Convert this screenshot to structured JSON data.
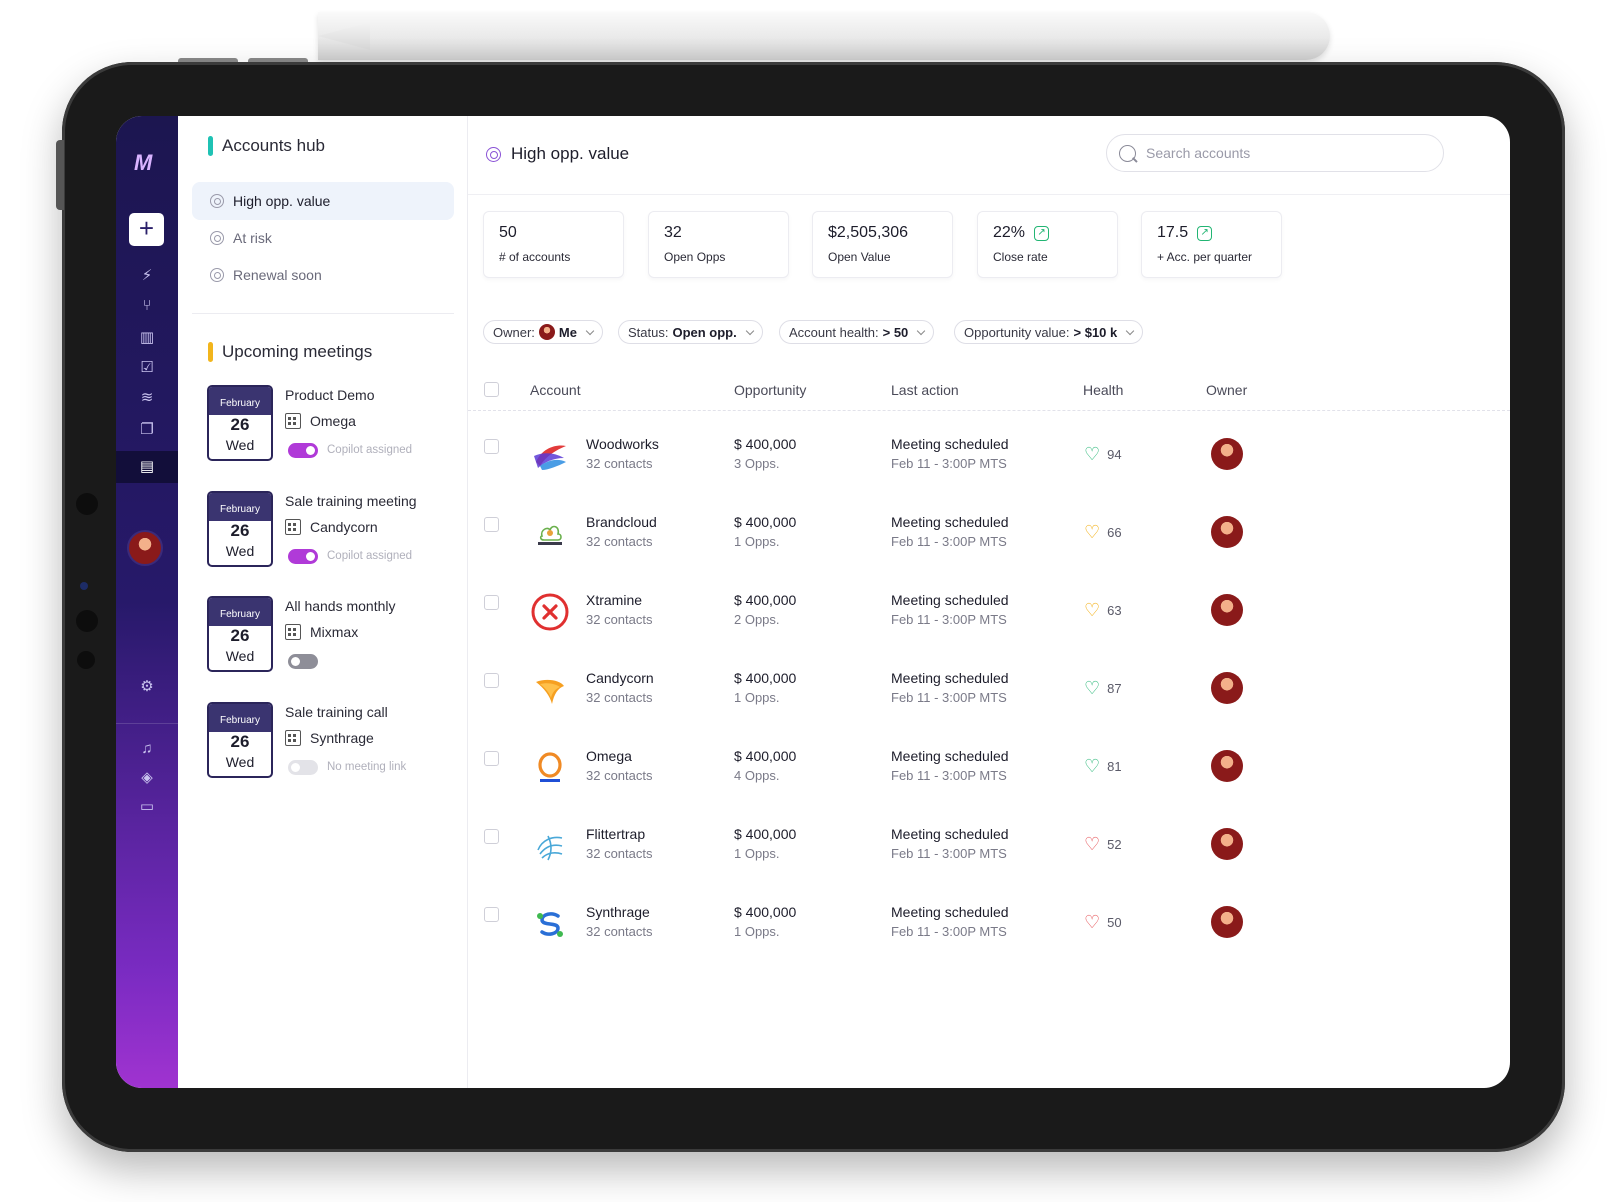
{
  "rail": {
    "logo_text": "M",
    "icons": [
      "plus-icon",
      "lightning-icon",
      "branch-icon",
      "chart-icon",
      "clipboard-icon",
      "layers-icon",
      "copy-icon",
      "document-icon",
      "gear-icon",
      "bell-icon",
      "graduation-cap-icon",
      "book-icon"
    ]
  },
  "hub": {
    "title": "Accounts hub",
    "accent_color": "#1fc2b4",
    "items": [
      {
        "label": "High opp. value",
        "active": true
      },
      {
        "label": "At risk",
        "active": false
      },
      {
        "label": "Renewal soon",
        "active": false
      }
    ]
  },
  "meetings": {
    "title": "Upcoming meetings",
    "accent_color": "#f2b51c",
    "items": [
      {
        "month": "February",
        "day": "26",
        "weekday": "Wed",
        "title": "Product Demo",
        "company": "Omega",
        "toggle": "on",
        "note": "Copilot assigned"
      },
      {
        "month": "February",
        "day": "26",
        "weekday": "Wed",
        "title": "Sale training meeting",
        "company": "Candycorn",
        "toggle": "on",
        "note": "Copilot assigned"
      },
      {
        "month": "February",
        "day": "26",
        "weekday": "Wed",
        "title": "All hands monthly",
        "company": "Mixmax",
        "toggle": "off",
        "note": ""
      },
      {
        "month": "February",
        "day": "26",
        "weekday": "Wed",
        "title": "Sale training call",
        "company": "Synthrage",
        "toggle": "disabled",
        "note": "No meeting link"
      }
    ]
  },
  "main": {
    "title": "High opp. value",
    "search_placeholder": "Search accounts",
    "kpis": [
      {
        "value": "50",
        "label": "# of accounts",
        "trend": false
      },
      {
        "value": "32",
        "label": "Open Opps",
        "trend": false
      },
      {
        "value": "$2,505,306",
        "label": "Open Value",
        "trend": false
      },
      {
        "value": "22%",
        "label": "Close rate",
        "trend": true
      },
      {
        "value": "17.5",
        "label": "+ Acc. per quarter",
        "trend": true
      }
    ],
    "filters": [
      {
        "label": "Owner:",
        "value": "Me",
        "avatar": true
      },
      {
        "label": "Status:",
        "value": "Open opp.",
        "avatar": false
      },
      {
        "label": "Account health:",
        "value": "> 50",
        "avatar": false
      },
      {
        "label": "Opportunity value:",
        "value": "> $10 k",
        "avatar": false
      }
    ],
    "columns": {
      "account": "Account",
      "opportunity": "Opportunity",
      "last_action": "Last action",
      "health": "Health",
      "owner": "Owner"
    },
    "rows": [
      {
        "name": "Woodworks",
        "contacts": "32 contacts",
        "value": "$ 400,000",
        "opps": "3 Opps.",
        "action": "Meeting scheduled",
        "action_time": "Feb 11 -  3:00P MTS",
        "health": "94",
        "health_color": "#22b573",
        "logo": "woodworks"
      },
      {
        "name": "Brandcloud",
        "contacts": "32 contacts",
        "value": "$ 400,000",
        "opps": "1 Opps.",
        "action": "Meeting scheduled",
        "action_time": "Feb 11 -  3:00P MTS",
        "health": "66",
        "health_color": "#f2a900",
        "logo": "brandcloud"
      },
      {
        "name": "Xtramine",
        "contacts": "32 contacts",
        "value": "$ 400,000",
        "opps": "2 Opps.",
        "action": "Meeting scheduled",
        "action_time": "Feb 11 -  3:00P MTS",
        "health": "63",
        "health_color": "#f2a900",
        "logo": "xtramine"
      },
      {
        "name": "Candycorn",
        "contacts": "32 contacts",
        "value": "$ 400,000",
        "opps": "1 Opps.",
        "action": "Meeting scheduled",
        "action_time": "Feb 11 -  3:00P MTS",
        "health": "87",
        "health_color": "#22b573",
        "logo": "candycorn"
      },
      {
        "name": "Omega",
        "contacts": "32 contacts",
        "value": "$ 400,000",
        "opps": "4 Opps.",
        "action": "Meeting scheduled",
        "action_time": "Feb 11 -  3:00P MTS",
        "health": "81",
        "health_color": "#22b573",
        "logo": "omega"
      },
      {
        "name": "Flittertrap",
        "contacts": "32 contacts",
        "value": "$ 400,000",
        "opps": "1 Opps.",
        "action": "Meeting scheduled",
        "action_time": "Feb 11 -  3:00P MTS",
        "health": "52",
        "health_color": "#e5484d",
        "logo": "flittertrap"
      },
      {
        "name": "Synthrage",
        "contacts": "32 contacts",
        "value": "$ 400,000",
        "opps": "1 Opps.",
        "action": "Meeting scheduled",
        "action_time": "Feb 11 -  3:00P MTS",
        "health": "50",
        "health_color": "#e5484d",
        "logo": "synthrage"
      }
    ]
  }
}
